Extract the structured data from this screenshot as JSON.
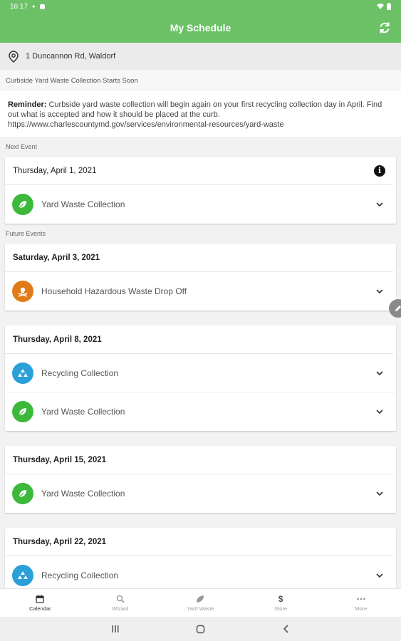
{
  "status_bar": {
    "time": "16:17"
  },
  "header": {
    "title": "My Schedule"
  },
  "address": "1 Duncannon Rd, Waldorf",
  "notice": {
    "title": "Curbside Yard Waste Collection Starts Soon",
    "reminder_label": "Reminder:",
    "body": "Curbside yard waste collection will begin again on your first recycling collection day in April. Find out what is accepted and how it should be placed at the curb. https://www.charlescountymd.gov/services/environmental-resources/yard-waste"
  },
  "next_event": {
    "label": "Next Event",
    "date": "Thursday, April 1, 2021",
    "items": [
      {
        "label": "Yard Waste Collection",
        "icon": "leaf-icon",
        "color": "#3cb93a"
      }
    ]
  },
  "future_events": {
    "label": "Future Events",
    "groups": [
      {
        "date": "Saturday, April 3, 2021",
        "items": [
          {
            "label": "Household Hazardous Waste Drop Off",
            "icon": "hazard-icon",
            "color": "#e07b18"
          }
        ]
      },
      {
        "date": "Thursday, April 8, 2021",
        "items": [
          {
            "label": "Recycling Collection",
            "icon": "recycle-icon",
            "color": "#2a9fd8"
          },
          {
            "label": "Yard Waste Collection",
            "icon": "leaf-icon",
            "color": "#3cb93a"
          }
        ]
      },
      {
        "date": "Thursday, April 15, 2021",
        "items": [
          {
            "label": "Yard Waste Collection",
            "icon": "leaf-icon",
            "color": "#3cb93a"
          }
        ]
      },
      {
        "date": "Thursday, April 22, 2021",
        "items": [
          {
            "label": "Recycling Collection",
            "icon": "recycle-icon",
            "color": "#2a9fd8"
          }
        ]
      }
    ]
  },
  "bottom_nav": [
    {
      "label": "Calendar",
      "icon": "calendar-icon",
      "active": true
    },
    {
      "label": "Wizard",
      "icon": "search-icon",
      "active": false
    },
    {
      "label": "Yard Waste",
      "icon": "leaf-icon",
      "active": false
    },
    {
      "label": "Store",
      "icon": "dollar-icon",
      "active": false
    },
    {
      "label": "More",
      "icon": "more-icon",
      "active": false
    }
  ],
  "colors": {
    "brand": "#6cc167",
    "leaf": "#3cb93a",
    "recycle": "#2a9fd8",
    "hazard": "#e07b18"
  }
}
